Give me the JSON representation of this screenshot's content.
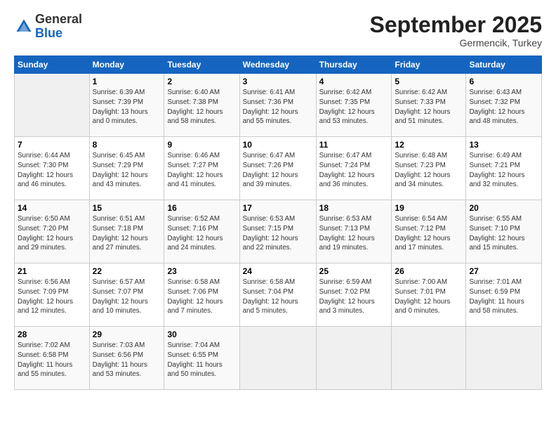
{
  "header": {
    "logo_general": "General",
    "logo_blue": "Blue",
    "month": "September 2025",
    "location": "Germencik, Turkey"
  },
  "days_of_week": [
    "Sunday",
    "Monday",
    "Tuesday",
    "Wednesday",
    "Thursday",
    "Friday",
    "Saturday"
  ],
  "weeks": [
    [
      {
        "num": "",
        "info": ""
      },
      {
        "num": "1",
        "info": "Sunrise: 6:39 AM\nSunset: 7:39 PM\nDaylight: 13 hours\nand 0 minutes."
      },
      {
        "num": "2",
        "info": "Sunrise: 6:40 AM\nSunset: 7:38 PM\nDaylight: 12 hours\nand 58 minutes."
      },
      {
        "num": "3",
        "info": "Sunrise: 6:41 AM\nSunset: 7:36 PM\nDaylight: 12 hours\nand 55 minutes."
      },
      {
        "num": "4",
        "info": "Sunrise: 6:42 AM\nSunset: 7:35 PM\nDaylight: 12 hours\nand 53 minutes."
      },
      {
        "num": "5",
        "info": "Sunrise: 6:42 AM\nSunset: 7:33 PM\nDaylight: 12 hours\nand 51 minutes."
      },
      {
        "num": "6",
        "info": "Sunrise: 6:43 AM\nSunset: 7:32 PM\nDaylight: 12 hours\nand 48 minutes."
      }
    ],
    [
      {
        "num": "7",
        "info": "Sunrise: 6:44 AM\nSunset: 7:30 PM\nDaylight: 12 hours\nand 46 minutes."
      },
      {
        "num": "8",
        "info": "Sunrise: 6:45 AM\nSunset: 7:29 PM\nDaylight: 12 hours\nand 43 minutes."
      },
      {
        "num": "9",
        "info": "Sunrise: 6:46 AM\nSunset: 7:27 PM\nDaylight: 12 hours\nand 41 minutes."
      },
      {
        "num": "10",
        "info": "Sunrise: 6:47 AM\nSunset: 7:26 PM\nDaylight: 12 hours\nand 39 minutes."
      },
      {
        "num": "11",
        "info": "Sunrise: 6:47 AM\nSunset: 7:24 PM\nDaylight: 12 hours\nand 36 minutes."
      },
      {
        "num": "12",
        "info": "Sunrise: 6:48 AM\nSunset: 7:23 PM\nDaylight: 12 hours\nand 34 minutes."
      },
      {
        "num": "13",
        "info": "Sunrise: 6:49 AM\nSunset: 7:21 PM\nDaylight: 12 hours\nand 32 minutes."
      }
    ],
    [
      {
        "num": "14",
        "info": "Sunrise: 6:50 AM\nSunset: 7:20 PM\nDaylight: 12 hours\nand 29 minutes."
      },
      {
        "num": "15",
        "info": "Sunrise: 6:51 AM\nSunset: 7:18 PM\nDaylight: 12 hours\nand 27 minutes."
      },
      {
        "num": "16",
        "info": "Sunrise: 6:52 AM\nSunset: 7:16 PM\nDaylight: 12 hours\nand 24 minutes."
      },
      {
        "num": "17",
        "info": "Sunrise: 6:53 AM\nSunset: 7:15 PM\nDaylight: 12 hours\nand 22 minutes."
      },
      {
        "num": "18",
        "info": "Sunrise: 6:53 AM\nSunset: 7:13 PM\nDaylight: 12 hours\nand 19 minutes."
      },
      {
        "num": "19",
        "info": "Sunrise: 6:54 AM\nSunset: 7:12 PM\nDaylight: 12 hours\nand 17 minutes."
      },
      {
        "num": "20",
        "info": "Sunrise: 6:55 AM\nSunset: 7:10 PM\nDaylight: 12 hours\nand 15 minutes."
      }
    ],
    [
      {
        "num": "21",
        "info": "Sunrise: 6:56 AM\nSunset: 7:09 PM\nDaylight: 12 hours\nand 12 minutes."
      },
      {
        "num": "22",
        "info": "Sunrise: 6:57 AM\nSunset: 7:07 PM\nDaylight: 12 hours\nand 10 minutes."
      },
      {
        "num": "23",
        "info": "Sunrise: 6:58 AM\nSunset: 7:06 PM\nDaylight: 12 hours\nand 7 minutes."
      },
      {
        "num": "24",
        "info": "Sunrise: 6:58 AM\nSunset: 7:04 PM\nDaylight: 12 hours\nand 5 minutes."
      },
      {
        "num": "25",
        "info": "Sunrise: 6:59 AM\nSunset: 7:02 PM\nDaylight: 12 hours\nand 3 minutes."
      },
      {
        "num": "26",
        "info": "Sunrise: 7:00 AM\nSunset: 7:01 PM\nDaylight: 12 hours\nand 0 minutes."
      },
      {
        "num": "27",
        "info": "Sunrise: 7:01 AM\nSunset: 6:59 PM\nDaylight: 11 hours\nand 58 minutes."
      }
    ],
    [
      {
        "num": "28",
        "info": "Sunrise: 7:02 AM\nSunset: 6:58 PM\nDaylight: 11 hours\nand 55 minutes."
      },
      {
        "num": "29",
        "info": "Sunrise: 7:03 AM\nSunset: 6:56 PM\nDaylight: 11 hours\nand 53 minutes."
      },
      {
        "num": "30",
        "info": "Sunrise: 7:04 AM\nSunset: 6:55 PM\nDaylight: 11 hours\nand 50 minutes."
      },
      {
        "num": "",
        "info": ""
      },
      {
        "num": "",
        "info": ""
      },
      {
        "num": "",
        "info": ""
      },
      {
        "num": "",
        "info": ""
      }
    ]
  ]
}
